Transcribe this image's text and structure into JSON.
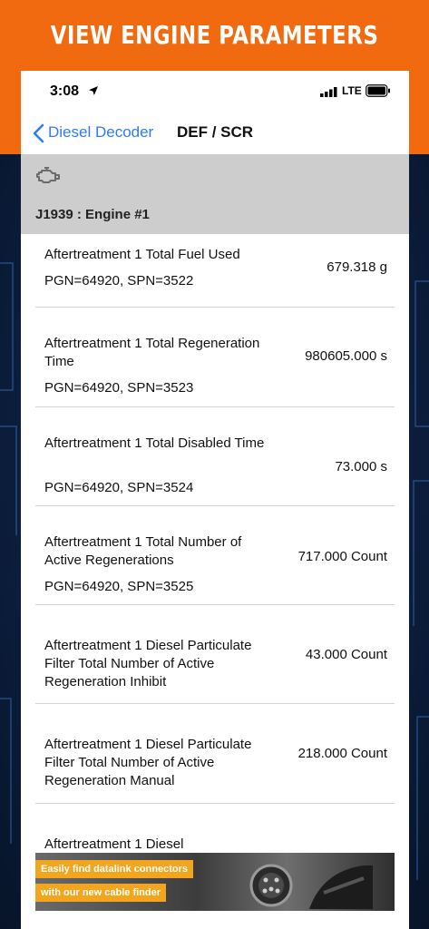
{
  "promo": {
    "title": "VIEW ENGINE PARAMETERS"
  },
  "status_bar": {
    "time": "3:08",
    "network": "LTE"
  },
  "nav": {
    "back_label": "Diesel Decoder",
    "title": "DEF / SCR"
  },
  "section": {
    "icon": "engine-icon",
    "title": "J1939 : Engine #1"
  },
  "parameters": [
    {
      "name": "Aftertreatment 1 Total Fuel Used",
      "pgn": "PGN=64920, SPN=3522",
      "value": "679.318 g"
    },
    {
      "name": "Aftertreatment 1 Total Regeneration Time",
      "pgn": "PGN=64920, SPN=3523",
      "value": "980605.000 s"
    },
    {
      "name": "Aftertreatment 1 Total Disabled Time",
      "pgn": "PGN=64920, SPN=3524",
      "value": "73.000 s"
    },
    {
      "name": "Aftertreatment 1 Total Number of Active Regenerations",
      "pgn": "PGN=64920, SPN=3525",
      "value": "717.000 Count"
    },
    {
      "name": "Aftertreatment 1 Diesel Particulate Filter Total Number of Active Regeneration Inhibit",
      "pgn": "",
      "value": "43.000 Count"
    },
    {
      "name": "Aftertreatment 1 Diesel Particulate Filter Total Number of Active Regeneration Manual",
      "pgn": "",
      "value": "218.000 Count"
    },
    {
      "name": "Aftertreatment 1 Diesel",
      "pgn": "",
      "value": ""
    }
  ],
  "banner": {
    "line1": "Easily find datalink connectors",
    "line2": "with our new cable finder"
  },
  "colors": {
    "accent": "#2f7bf5",
    "promo_orange": "#f26a0f",
    "banner_orange": "#f3a51d"
  }
}
